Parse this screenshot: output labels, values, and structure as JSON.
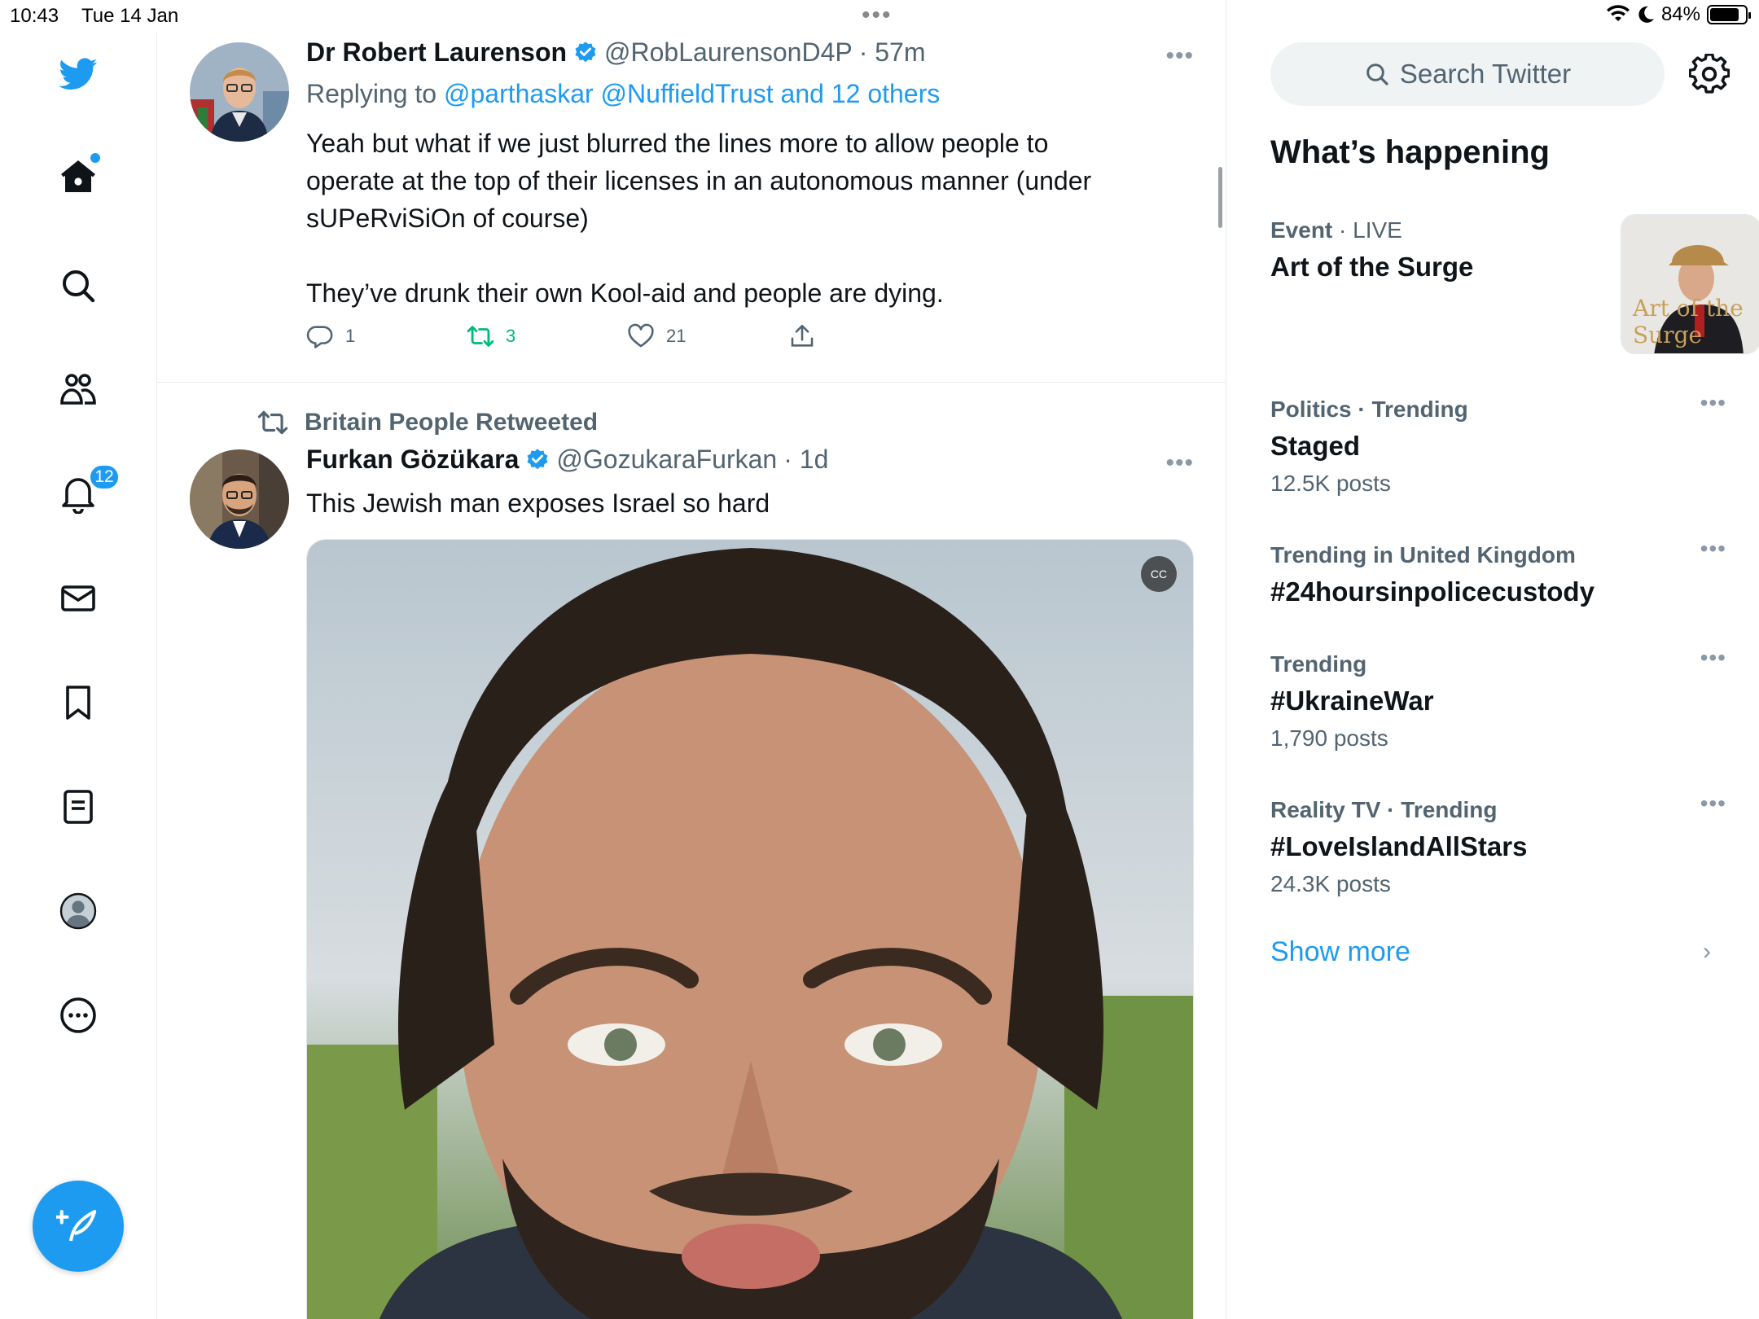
{
  "status_bar": {
    "time": "10:43",
    "date": "Tue 14 Jan",
    "battery": "84%",
    "battery_level": 0.84
  },
  "nav": {
    "notifications_badge": "12"
  },
  "tweets": [
    {
      "name": "Dr Robert Laurenson",
      "handle": "@RobLaurensonD4P",
      "time": "· 57m",
      "replying_prefix": "Replying to",
      "replying_to": "@parthaskar @NuffieldTrust and 12 others",
      "text_line1": "Yeah but what if we just blurred the lines more to allow people to",
      "text_line2": "operate at the top of their licenses in an autonomous manner (under",
      "text_line3": "sUPeRviSiOn of course)",
      "text_line4": "They’ve drunk their own Kool-aid and people are dying.",
      "replies": "1",
      "retweets": "3",
      "likes": "21"
    },
    {
      "retweeted_by": "Britain People Retweeted",
      "name": "Furkan Gözükara",
      "handle": "@GozukaraFurkan",
      "time": "· 1d",
      "text": "This Jewish man exposes Israel so hard"
    }
  ],
  "sidebar": {
    "search_placeholder": "Search Twitter",
    "title": "What’s happening",
    "trends": [
      {
        "category": "Event",
        "status": "· LIVE",
        "name": "Art of the Surge",
        "image_text": "Art of the Surge"
      },
      {
        "category": "Politics · Trending",
        "name": "Staged",
        "count": "12.5K posts"
      },
      {
        "category": "Trending in United Kingdom",
        "name": "#24hoursinpolicecustody"
      },
      {
        "category": "Trending",
        "name": "#UkraineWar",
        "count": "1,790 posts"
      },
      {
        "category": "Reality TV · Trending",
        "name": "#LoveIslandAllStars",
        "count": "24.3K posts"
      }
    ],
    "show_more": "Show more"
  },
  "colors": {
    "accent": "#1d9bf0",
    "retweet_green": "#00ba7c",
    "secondary_text": "#536471"
  }
}
